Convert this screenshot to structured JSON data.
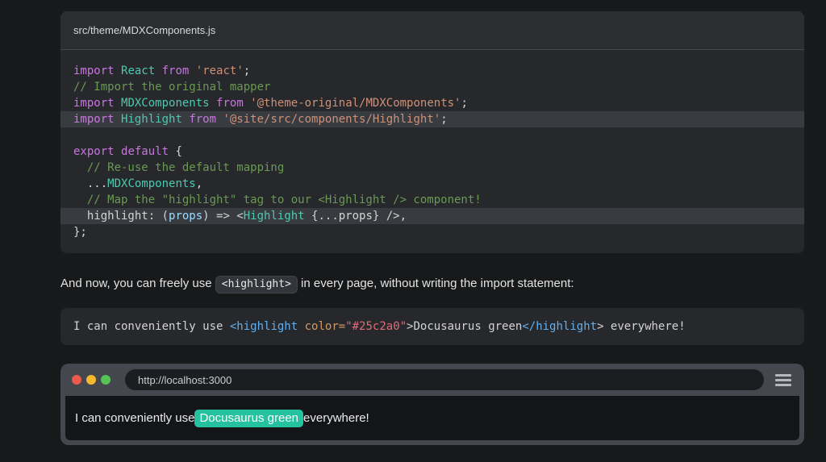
{
  "colors": {
    "page_bg": "#18191a",
    "code_bg": "#26282c",
    "code_title_bg": "#2b2d31",
    "divider": "#45484e",
    "line_highlight": "#383b40",
    "inline_code_bg": "#33353a",
    "browser_frame": "#44484e",
    "browser_url_bg": "#1b1d21",
    "browser_body_bg": "#131518",
    "accent_green": "#25c2a0",
    "dot_red": "#ed594a",
    "dot_yellow": "#f5b82e",
    "dot_green": "#55c455",
    "text_primary": "#e3e3e3"
  },
  "token_colors": {
    "plain": "#d4d4d4",
    "keyword": "#c678dd",
    "component": "#4ec9b0",
    "string": "#ce9178",
    "comment": "#6a9955",
    "param": "#9cdcfe",
    "tag": "#61afef",
    "attr": "#d19a66",
    "value": "#e06c75"
  },
  "code_block_1": {
    "title": "src/theme/MDXComponents.js",
    "lines": [
      {
        "hl": false,
        "tokens": [
          {
            "t": "import",
            "c": "keyword"
          },
          {
            "t": " ",
            "c": "plain"
          },
          {
            "t": "React",
            "c": "component"
          },
          {
            "t": " ",
            "c": "plain"
          },
          {
            "t": "from",
            "c": "keyword"
          },
          {
            "t": " ",
            "c": "plain"
          },
          {
            "t": "'react'",
            "c": "string"
          },
          {
            "t": ";",
            "c": "plain"
          }
        ]
      },
      {
        "hl": false,
        "tokens": [
          {
            "t": "// Import the original mapper",
            "c": "comment"
          }
        ]
      },
      {
        "hl": false,
        "tokens": [
          {
            "t": "import",
            "c": "keyword"
          },
          {
            "t": " ",
            "c": "plain"
          },
          {
            "t": "MDXComponents",
            "c": "component"
          },
          {
            "t": " ",
            "c": "plain"
          },
          {
            "t": "from",
            "c": "keyword"
          },
          {
            "t": " ",
            "c": "plain"
          },
          {
            "t": "'@theme-original/MDXComponents'",
            "c": "string"
          },
          {
            "t": ";",
            "c": "plain"
          }
        ]
      },
      {
        "hl": true,
        "tokens": [
          {
            "t": "import",
            "c": "keyword"
          },
          {
            "t": " ",
            "c": "plain"
          },
          {
            "t": "Highlight",
            "c": "component"
          },
          {
            "t": " ",
            "c": "plain"
          },
          {
            "t": "from",
            "c": "keyword"
          },
          {
            "t": " ",
            "c": "plain"
          },
          {
            "t": "'@site/src/components/Highlight'",
            "c": "string"
          },
          {
            "t": ";",
            "c": "plain"
          }
        ]
      },
      {
        "hl": false,
        "tokens": []
      },
      {
        "hl": false,
        "tokens": [
          {
            "t": "export",
            "c": "keyword"
          },
          {
            "t": " ",
            "c": "plain"
          },
          {
            "t": "default",
            "c": "keyword"
          },
          {
            "t": " {",
            "c": "plain"
          }
        ]
      },
      {
        "hl": false,
        "tokens": [
          {
            "t": "  // Re-use the default mapping",
            "c": "comment"
          }
        ]
      },
      {
        "hl": false,
        "tokens": [
          {
            "t": "  ...",
            "c": "plain"
          },
          {
            "t": "MDXComponents",
            "c": "component"
          },
          {
            "t": ",",
            "c": "plain"
          }
        ]
      },
      {
        "hl": false,
        "tokens": [
          {
            "t": "  // Map the \"highlight\" tag to our <Highlight /> component!",
            "c": "comment"
          }
        ]
      },
      {
        "hl": true,
        "tokens": [
          {
            "t": "  highlight: (",
            "c": "plain"
          },
          {
            "t": "props",
            "c": "param"
          },
          {
            "t": ") => <",
            "c": "plain"
          },
          {
            "t": "Highlight",
            "c": "component"
          },
          {
            "t": " {...props} />,",
            "c": "plain"
          }
        ]
      },
      {
        "hl": false,
        "tokens": [
          {
            "t": "};",
            "c": "plain"
          }
        ]
      }
    ]
  },
  "paragraph": {
    "before": "And now, you can freely use ",
    "code": "<highlight>",
    "after": " in every page, without writing the import statement:"
  },
  "code_block_2": {
    "lines": [
      {
        "hl": false,
        "tokens": [
          {
            "t": "I can conveniently use ",
            "c": "plain"
          },
          {
            "t": "<highlight",
            "c": "tag"
          },
          {
            "t": " ",
            "c": "plain"
          },
          {
            "t": "color=",
            "c": "attr"
          },
          {
            "t": "\"#25c2a0\"",
            "c": "value"
          },
          {
            "t": ">Docusaurus green",
            "c": "plain"
          },
          {
            "t": "</highlight",
            "c": "tag"
          },
          {
            "t": ">",
            "c": "plain"
          },
          {
            "t": " everywhere!",
            "c": "plain"
          }
        ]
      }
    ]
  },
  "browser": {
    "url": "http://localhost:3000",
    "menu_icon": "hamburger-icon",
    "body": {
      "before": "I can conveniently use ",
      "highlight": "Docusaurus green",
      "after": " everywhere!"
    }
  }
}
